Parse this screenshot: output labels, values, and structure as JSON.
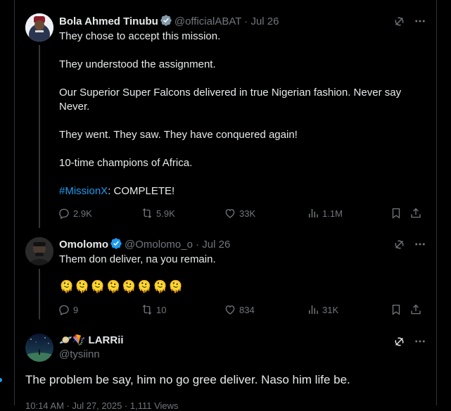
{
  "tweets": [
    {
      "name": "Bola Ahmed Tinubu",
      "handle": "@officialABAT",
      "sep": "·",
      "date": "Jul 26",
      "lines": [
        "They chose to accept this mission.",
        "They understood the assignment.",
        "Our Superior Super Falcons delivered in true Nigerian fashion. Never say",
        "Never.",
        "They went. They saw. They have conquered again!",
        "10-time champions of Africa."
      ],
      "hashtag": "#MissionX",
      "hashtag_rest": ": COMPLETE!",
      "replies": "2.9K",
      "reposts": "5.9K",
      "likes": "33K",
      "views": "1.1M"
    },
    {
      "name": "Omolomo",
      "handle": "@Omolomo_o",
      "sep": "·",
      "date": "Jul 26",
      "text": "Them don deliver, na you remain.",
      "emojis": "🫠🫠🫠🫠🫠🫠🫠🫠",
      "replies": "9",
      "reposts": "10",
      "likes": "834",
      "views": "31K"
    }
  ],
  "main": {
    "name_emojis": "🪐🪁",
    "name": "LARRii",
    "handle": "@tysiinn",
    "text": "The problem be say, him no go gree deliver. Naso him life be.",
    "footer": "10:14 AM · Jul 27, 2025 · 1,111 Views"
  },
  "colors": {
    "background": "#000000",
    "text": "#e7e9ea",
    "muted": "#71767b",
    "accent": "#1d9bf0",
    "border": "#2f3336"
  }
}
